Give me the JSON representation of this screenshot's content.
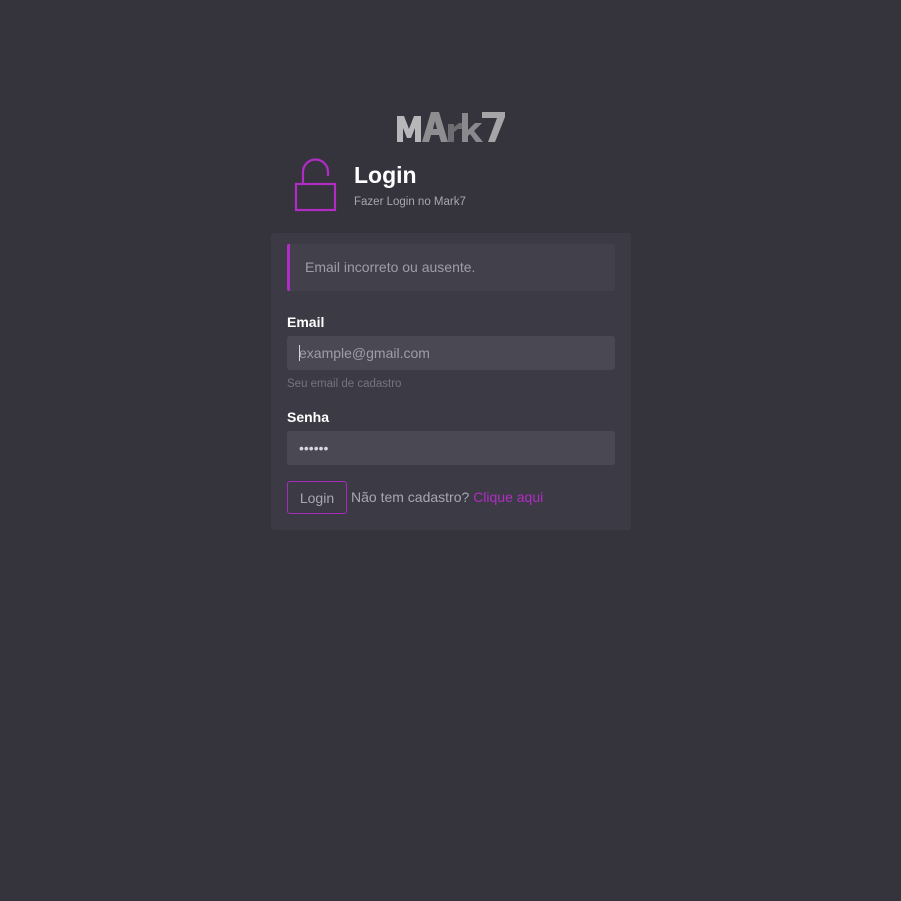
{
  "brand": {
    "logo_text": "MArk7"
  },
  "header": {
    "icon": "lock-open-icon",
    "title": "Login",
    "subtitle": "Fazer Login no Mark7"
  },
  "alert": {
    "message": "Email incorreto ou ausente."
  },
  "form": {
    "email": {
      "label": "Email",
      "placeholder": "example@gmail.com",
      "value": "",
      "help": "Seu email de cadastro"
    },
    "password": {
      "label": "Senha",
      "value": "••••••"
    },
    "submit_label": "Login",
    "signup_prompt": "Não tem cadastro?",
    "signup_link": "Clique aqui"
  },
  "colors": {
    "background": "#35343d",
    "card": "#3c3b45",
    "accent": "#b12cc4",
    "input": "#4a4953"
  }
}
